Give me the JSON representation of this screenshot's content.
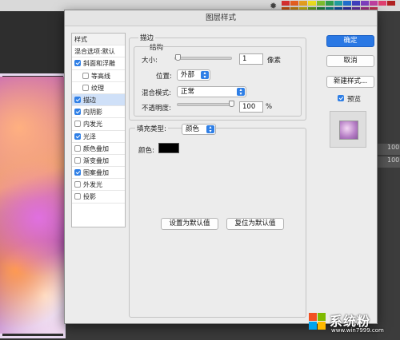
{
  "dialog": {
    "title": "图层样式"
  },
  "styles": {
    "header": "样式",
    "items": [
      {
        "label": "混合选项:默认",
        "checkbox": false,
        "checked": false,
        "sub": false,
        "selected": false,
        "name": "blend-options"
      },
      {
        "label": "斜面和浮雕",
        "checkbox": true,
        "checked": true,
        "sub": false,
        "selected": false,
        "name": "bevel-emboss"
      },
      {
        "label": "等高线",
        "checkbox": true,
        "checked": false,
        "sub": true,
        "selected": false,
        "name": "contour"
      },
      {
        "label": "纹理",
        "checkbox": true,
        "checked": false,
        "sub": true,
        "selected": false,
        "name": "texture"
      },
      {
        "label": "描边",
        "checkbox": true,
        "checked": true,
        "sub": false,
        "selected": true,
        "name": "stroke"
      },
      {
        "label": "内阴影",
        "checkbox": true,
        "checked": true,
        "sub": false,
        "selected": false,
        "name": "inner-shadow"
      },
      {
        "label": "内发光",
        "checkbox": true,
        "checked": false,
        "sub": false,
        "selected": false,
        "name": "inner-glow"
      },
      {
        "label": "光泽",
        "checkbox": true,
        "checked": true,
        "sub": false,
        "selected": false,
        "name": "satin"
      },
      {
        "label": "颜色叠加",
        "checkbox": true,
        "checked": false,
        "sub": false,
        "selected": false,
        "name": "color-overlay"
      },
      {
        "label": "渐变叠加",
        "checkbox": true,
        "checked": false,
        "sub": false,
        "selected": false,
        "name": "gradient-overlay"
      },
      {
        "label": "图案叠加",
        "checkbox": true,
        "checked": true,
        "sub": false,
        "selected": false,
        "name": "pattern-overlay"
      },
      {
        "label": "外发光",
        "checkbox": true,
        "checked": false,
        "sub": false,
        "selected": false,
        "name": "outer-glow"
      },
      {
        "label": "投影",
        "checkbox": true,
        "checked": false,
        "sub": false,
        "selected": false,
        "name": "drop-shadow"
      }
    ]
  },
  "stroke": {
    "section_title": "描边",
    "structure_title": "结构",
    "size_label": "大小:",
    "size_value": "1",
    "size_unit": "像素",
    "size_slider_fraction": 0.02,
    "position_label": "位置:",
    "position_value": "外部",
    "blend_label": "混合模式:",
    "blend_value": "正常",
    "opacity_label": "不透明度:",
    "opacity_value": "100",
    "opacity_unit": "%",
    "opacity_slider_fraction": 1.0,
    "fill_type_label": "填充类型:",
    "fill_type_value": "颜色",
    "color_label": "颜色:",
    "color_value": "#000000"
  },
  "buttons": {
    "ok": "确定",
    "cancel": "取消",
    "new_style": "新建样式...",
    "preview": "预览",
    "preview_checked": true,
    "set_default": "设置为默认值",
    "reset_default": "复位为默认值"
  },
  "background": {
    "layer_rows": [
      "100",
      "100"
    ],
    "swatch_colors": [
      "#d83030",
      "#e86020",
      "#e8a020",
      "#f0e020",
      "#80c030",
      "#30a050",
      "#20a0a0",
      "#2070d0",
      "#4040c0",
      "#8040c0",
      "#c040a0",
      "#e04070",
      "#b02020",
      "#c05010",
      "#c08010",
      "#c0b010",
      "#60a020",
      "#208040",
      "#108080",
      "#1050a0",
      "#3030a0",
      "#6030a0",
      "#a03080",
      "#c03050"
    ]
  },
  "watermark": {
    "title": "系统粉",
    "url": "www.win7999.com"
  }
}
